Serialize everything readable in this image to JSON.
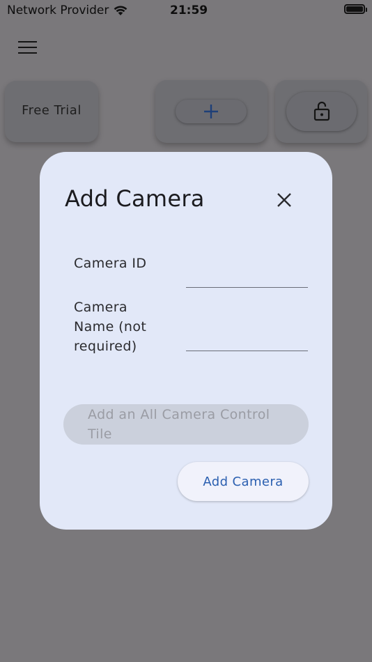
{
  "status_bar": {
    "carrier": "Network Provider",
    "time": "21:59"
  },
  "background": {
    "free_trial_label": "Free Trial"
  },
  "dialog": {
    "title": "Add Camera",
    "camera_id_label": "Camera ID",
    "camera_id_value": "",
    "camera_name_label": "Camera Name (not required)",
    "camera_name_value": "",
    "all_camera_button_label": "Add an All Camera Control Tile",
    "add_camera_button_label": "Add Camera"
  },
  "colors": {
    "accent": "#2a5fb0",
    "dialog_bg": "#e2e8f8",
    "scrim": "#7a787b"
  }
}
